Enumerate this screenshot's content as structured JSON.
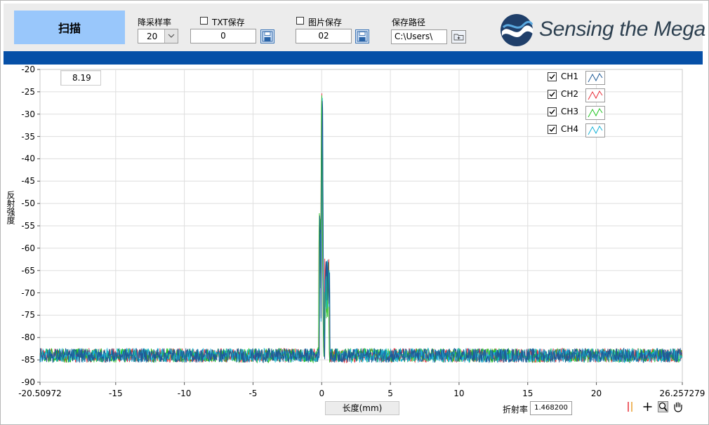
{
  "toolbar": {
    "scan_label": "扫描",
    "downsample": {
      "label": "降采样率",
      "value": "20"
    },
    "txt_save": {
      "label": "TXT保存",
      "checked": false,
      "value": "0"
    },
    "img_save": {
      "label": "图片保存",
      "checked": false,
      "value": "02"
    },
    "save_path": {
      "label": "保存路径",
      "value": "C:\\Users\\"
    },
    "logo_text": "Sensing the Mega"
  },
  "cursor_readout": "8.19",
  "legend": [
    {
      "name": "CH1",
      "checked": true,
      "color": "#1f5a96"
    },
    {
      "name": "CH2",
      "checked": true,
      "color": "#e8303a"
    },
    {
      "name": "CH3",
      "checked": true,
      "color": "#22c422"
    },
    {
      "name": "CH4",
      "checked": true,
      "color": "#19b2d6"
    }
  ],
  "refractive_index": {
    "label": "折射率",
    "value": "1.468200"
  },
  "chart_data": {
    "type": "line",
    "xlabel": "长度(mm)",
    "ylabel": "反射强度",
    "xlim": [
      -20.50972,
      26.257279
    ],
    "ylim": [
      -90,
      -20
    ],
    "xticks": [
      "-20.50972",
      "-15",
      "-10",
      "-5",
      "0",
      "5",
      "10",
      "15",
      "20",
      "26.257279"
    ],
    "yticks": [
      "-20",
      "-25",
      "-30",
      "-35",
      "-40",
      "-45",
      "-50",
      "-55",
      "-60",
      "-65",
      "-70",
      "-75",
      "-80",
      "-85",
      "-90"
    ],
    "grid": true,
    "legend_position": "top-right",
    "series": [
      {
        "name": "CH1",
        "color": "#1f5a96",
        "noise_floor": -84,
        "peak_x": 0.05,
        "peak_y": -26
      },
      {
        "name": "CH2",
        "color": "#e8303a",
        "noise_floor": -84,
        "peak_x": 0.0,
        "peak_y": -24
      },
      {
        "name": "CH3",
        "color": "#22c422",
        "noise_floor": -84,
        "peak_x": 0.0,
        "peak_y": -25
      },
      {
        "name": "CH4",
        "color": "#19b2d6",
        "noise_floor": -84,
        "peak_x": 0.05,
        "peak_y": -27
      }
    ]
  }
}
